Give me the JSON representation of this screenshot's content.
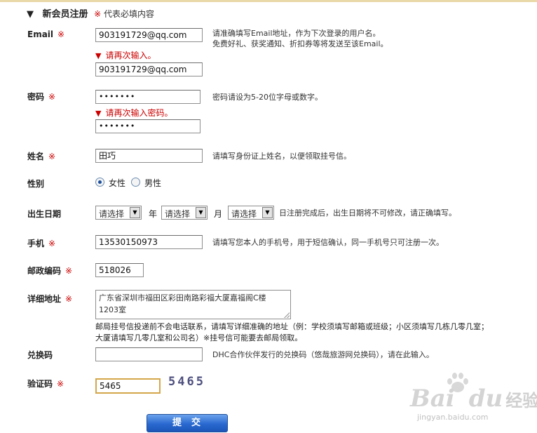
{
  "header": {
    "triangle": "▼",
    "title": "新会员注册",
    "star": "※",
    "required_note": "代表必填内容"
  },
  "required_mark": "※",
  "error_triangle": "▼",
  "email": {
    "label": "Email",
    "value": "903191729@qq.com",
    "hint_line1": "请准确填写Email地址，作为下次登录的用户名。",
    "hint_line2": "免费好礼、获奖通知、折扣券等将发送至该Email。",
    "error": "请再次输入。",
    "confirm_value": "903191729@qq.com"
  },
  "password": {
    "label": "密码",
    "value": "•••••••",
    "hint": "密码请设为5-20位字母或数字。",
    "error": "请再次输入密码。",
    "confirm_value": "•••••••"
  },
  "name": {
    "label": "姓名",
    "value": "田巧",
    "hint": "请填写身份证上姓名，以便领取挂号信。"
  },
  "gender": {
    "label": "性别",
    "options": [
      "女性",
      "男性"
    ],
    "selected": "女性"
  },
  "birthday": {
    "label": "出生日期",
    "year_select": "请选择",
    "year_unit": "年",
    "month_select": "请选择",
    "month_unit": "月",
    "day_select": "请选择",
    "hint": "日注册完成后，出生日期将不可修改，请正确填写。",
    "dropdown_arrow": "▼"
  },
  "phone": {
    "label": "手机",
    "value": "13530150973",
    "hint": "请填写您本人的手机号，用于短信确认，同一手机号只可注册一次。"
  },
  "postcode": {
    "label": "邮政编码",
    "value": "518026"
  },
  "address": {
    "label": "详细地址",
    "value_line1": "广东省深圳市福田区彩田南路彩福大厦嘉福阁C楼",
    "value_line2": "1203室",
    "hint_line1": "邮局挂号信投递前不会电话联系，请填写详细准确的地址（例：学校须填写邮箱或班级；小区须填写几栋几零几室；",
    "hint_line2": "大厦请填写几零几室和公司名）※挂号信可能要去邮局领取。"
  },
  "coupon": {
    "label": "兑换码",
    "value": "",
    "hint": "DHC合作伙伴发行的兑换码（悠哉旅游网兑换码），请在此输入。"
  },
  "captcha": {
    "label": "验证码",
    "value": "5465",
    "image_text": "5465"
  },
  "submit": {
    "label": "提交"
  },
  "watermark": {
    "logo": "Bai",
    "logo2": "du",
    "text": "经验",
    "url": "jingyan.baidu.com"
  },
  "colors": {
    "required": "#cc0000",
    "button": "#2a69d0",
    "captcha_border": "#d4a64a"
  }
}
